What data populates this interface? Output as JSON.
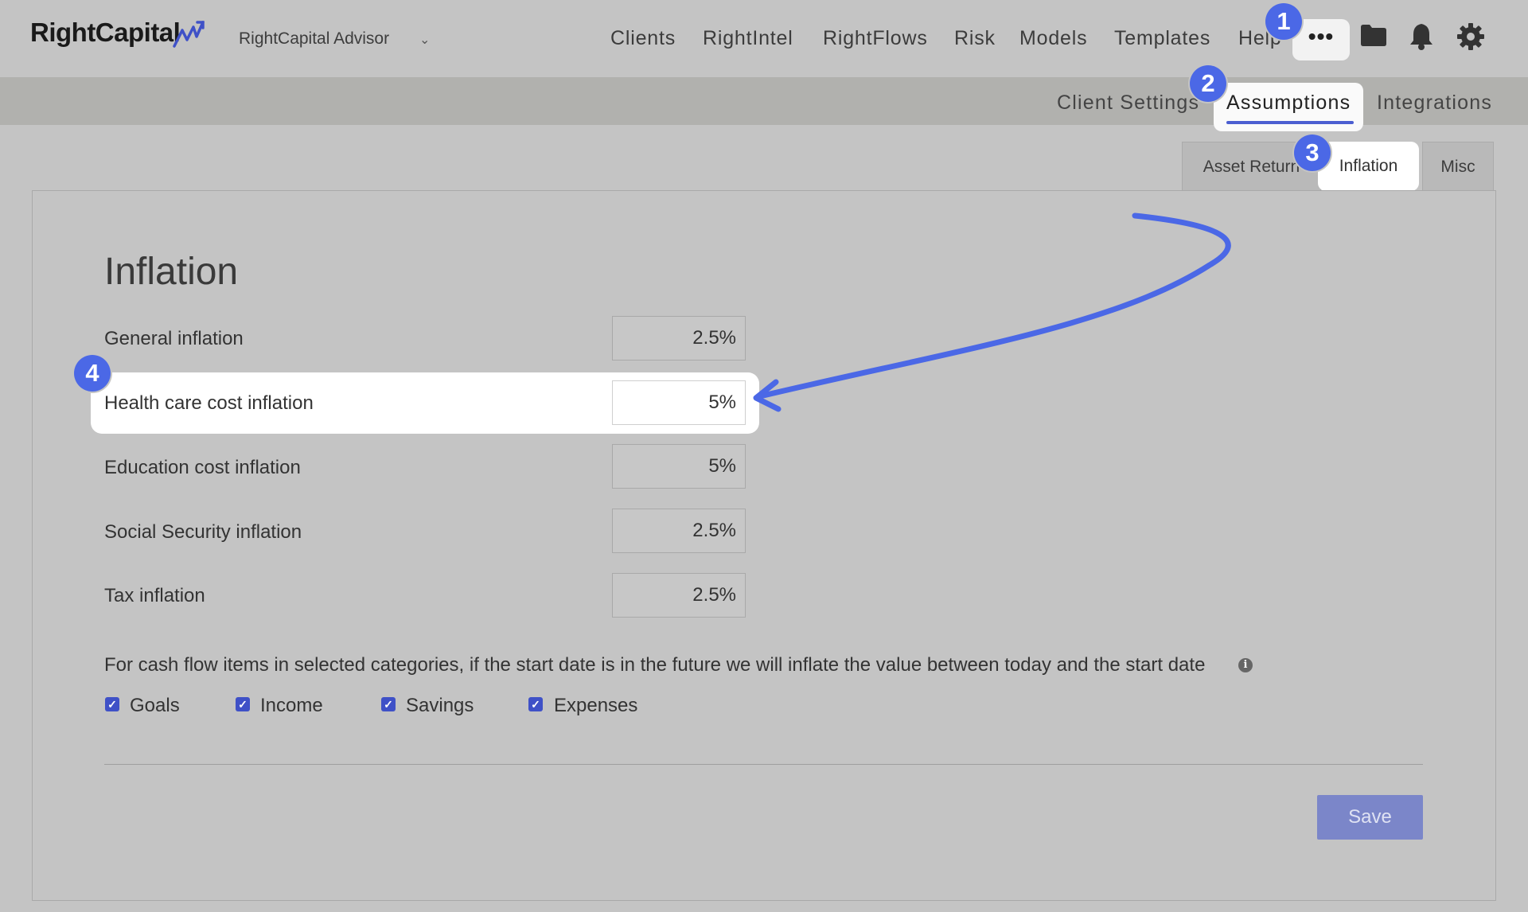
{
  "brand": {
    "logo_text": "RightCapital"
  },
  "header": {
    "advisor_name": "RightCapital Advisor",
    "nav": [
      "Clients",
      "RightIntel",
      "RightFlows",
      "Risk",
      "Models",
      "Templates",
      "Help"
    ],
    "more_label": "•••"
  },
  "subnav": {
    "items": [
      "Client Settings",
      "Assumptions",
      "Integrations"
    ],
    "active": "Assumptions"
  },
  "tabs": {
    "items": [
      "Asset Return",
      "Inflation",
      "Misc"
    ],
    "active": "Inflation"
  },
  "page": {
    "title": "Inflation",
    "rows": [
      {
        "label": "General inflation",
        "value": "2.5%"
      },
      {
        "label": "Health care cost inflation",
        "value": "5%"
      },
      {
        "label": "Education cost inflation",
        "value": "5%"
      },
      {
        "label": "Social Security inflation",
        "value": "2.5%"
      },
      {
        "label": "Tax inflation",
        "value": "2.5%"
      }
    ],
    "note": "For cash flow items in selected categories, if the start date is in the future we will inflate the value between today and the start date",
    "checkboxes": [
      {
        "label": "Goals",
        "checked": true
      },
      {
        "label": "Income",
        "checked": true
      },
      {
        "label": "Savings",
        "checked": true
      },
      {
        "label": "Expenses",
        "checked": true
      }
    ],
    "save_label": "Save"
  },
  "badges": [
    "1",
    "2",
    "3",
    "4"
  ],
  "colors": {
    "accent": "#4b68e6",
    "checkbox": "#3f51c7",
    "save": "#7b86c9"
  }
}
